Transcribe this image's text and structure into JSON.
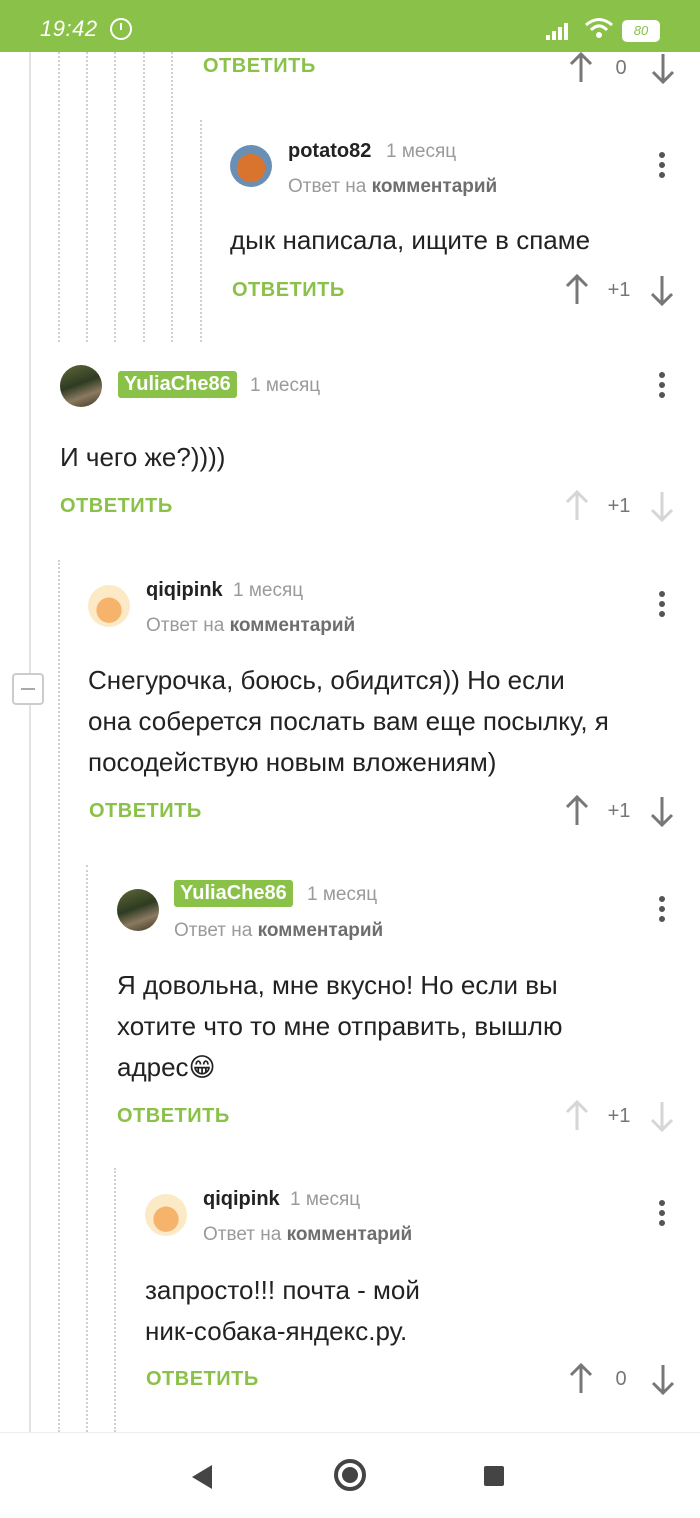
{
  "status_bar": {
    "time": "19:42",
    "battery": "80"
  },
  "colors": {
    "accent": "#8ac148",
    "status_bar": "#8ac148"
  },
  "labels": {
    "reply": "ОТВЕТИТЬ",
    "reply_to_prefix": "Ответ на",
    "reply_to_target": "комментарий"
  },
  "comments": [
    {
      "id": "c0",
      "user": "",
      "time": "",
      "body": "",
      "score": "0",
      "partial": true
    },
    {
      "id": "c1",
      "user": "potato82",
      "time": "1 месяц",
      "reply_to": true,
      "body": "дык написала, ищите в спаме",
      "score": "+1"
    },
    {
      "id": "c2",
      "user": "YuliaChe86",
      "badge": true,
      "time": "1 месяц",
      "reply_to": false,
      "body": "И чего же?))))",
      "score": "+1"
    },
    {
      "id": "c3",
      "user": "qiqipink",
      "time": "1 месяц",
      "reply_to": true,
      "body_lines": [
        "Снегурочка, боюсь, обидится)) Но если",
        "она соберется послать вам еще посылку, я",
        "посодействую новым вложениям)"
      ],
      "score": "+1"
    },
    {
      "id": "c4",
      "user": "YuliaChe86",
      "badge": true,
      "time": "1 месяц",
      "reply_to": true,
      "body_lines": [
        "Я довольна, мне вкусно! Но если вы",
        "хотите что то мне отправить, вышлю",
        "адрес😁"
      ],
      "score": "+1"
    },
    {
      "id": "c5",
      "user": "qiqipink",
      "time": "1 месяц",
      "reply_to": true,
      "body_lines": [
        "запросто!!! почта - мой",
        "ник-собака-яндекс.ру."
      ],
      "score": "0"
    }
  ],
  "icons": {
    "avatar_potato": "potato-avatar",
    "avatar_yulia": "photo-avatar",
    "avatar_qiqi": "chef-avatar",
    "upvote": "arrow-up-icon",
    "downvote": "arrow-down-icon",
    "more": "kebab-menu-icon"
  }
}
